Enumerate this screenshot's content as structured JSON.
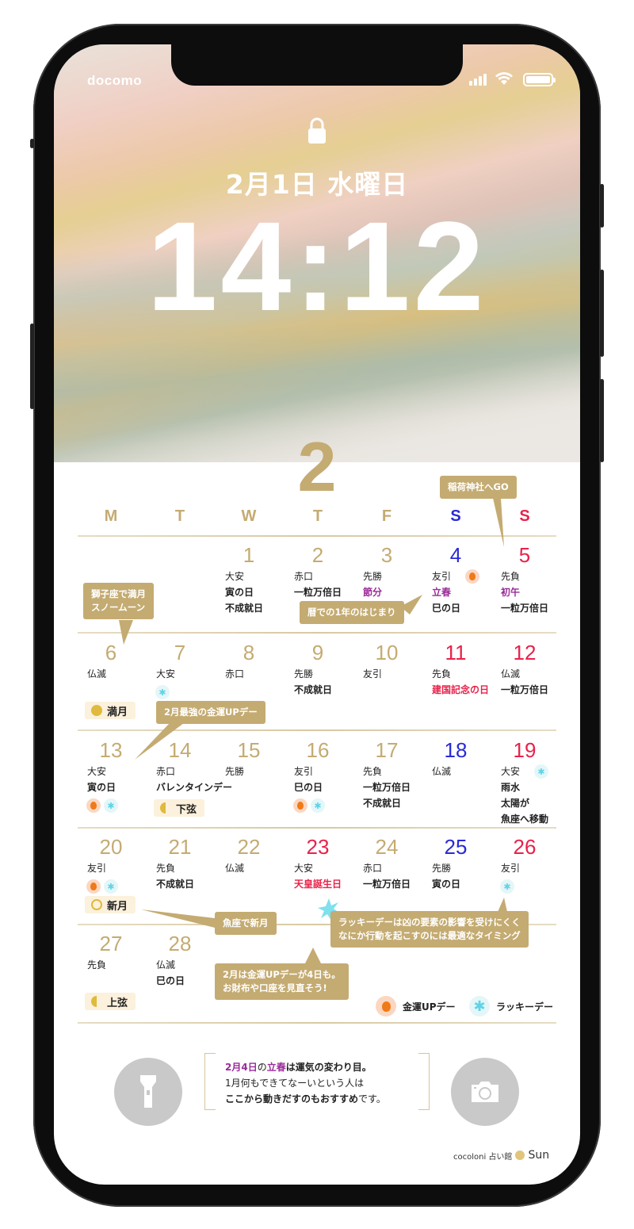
{
  "status": {
    "carrier": "docomo"
  },
  "lockscreen": {
    "date": "2月1日 水曜日",
    "time": "14:12"
  },
  "calendar": {
    "month": "2",
    "weekdays": [
      {
        "label": "M",
        "color": "gold"
      },
      {
        "label": "T",
        "color": "gold"
      },
      {
        "label": "W",
        "color": "gold"
      },
      {
        "label": "T",
        "color": "gold"
      },
      {
        "label": "F",
        "color": "gold"
      },
      {
        "label": "S",
        "color": "blue"
      },
      {
        "label": "S",
        "color": "red"
      }
    ],
    "weeks": [
      [
        null,
        null,
        {
          "day": "1",
          "color": "gold",
          "lines": [
            {
              "t": "大安"
            },
            {
              "t": "寅の日",
              "s": "b"
            },
            {
              "t": "不成就日",
              "s": "b"
            }
          ]
        },
        {
          "day": "2",
          "color": "gold",
          "lines": [
            {
              "t": "赤口"
            },
            {
              "t": "一粒万倍日",
              "s": "b"
            }
          ]
        },
        {
          "day": "3",
          "color": "gold",
          "lines": [
            {
              "t": "先勝"
            },
            {
              "t": "節分",
              "s": "purple"
            }
          ]
        },
        {
          "day": "4",
          "color": "blue",
          "lines": [
            {
              "t": "友引"
            },
            {
              "t": "立春",
              "s": "purple"
            },
            {
              "t": "巳の日",
              "s": "b"
            }
          ],
          "inline_icons": [
            "money"
          ]
        },
        {
          "day": "5",
          "color": "red",
          "lines": [
            {
              "t": "先負"
            },
            {
              "t": "初午",
              "s": "purple"
            },
            {
              "t": "一粒万倍日",
              "s": "b"
            }
          ]
        }
      ],
      [
        {
          "day": "6",
          "color": "gold",
          "lines": [
            {
              "t": "仏滅"
            }
          ],
          "moon": {
            "label": "満月",
            "phase": "full"
          }
        },
        {
          "day": "7",
          "color": "gold",
          "lines": [
            {
              "t": "大安"
            }
          ],
          "icons": [
            "lucky"
          ]
        },
        {
          "day": "8",
          "color": "gold",
          "lines": [
            {
              "t": "赤口"
            }
          ]
        },
        {
          "day": "9",
          "color": "gold",
          "lines": [
            {
              "t": "先勝"
            },
            {
              "t": "不成就日",
              "s": "b"
            }
          ]
        },
        {
          "day": "10",
          "color": "gold",
          "lines": [
            {
              "t": "友引"
            }
          ]
        },
        {
          "day": "11",
          "color": "red",
          "lines": [
            {
              "t": "先負"
            },
            {
              "t": "建国記念の日",
              "s": "red"
            }
          ]
        },
        {
          "day": "12",
          "color": "red",
          "lines": [
            {
              "t": "仏滅"
            },
            {
              "t": "一粒万倍日",
              "s": "b"
            }
          ]
        }
      ],
      [
        {
          "day": "13",
          "color": "gold",
          "lines": [
            {
              "t": "大安"
            },
            {
              "t": "寅の日",
              "s": "b"
            }
          ],
          "icons": [
            "money",
            "lucky"
          ]
        },
        {
          "day": "14",
          "color": "gold",
          "lines": [
            {
              "t": "赤口"
            },
            {
              "t": "バレンタインデー",
              "s": "b"
            }
          ],
          "moon": {
            "label": "下弦",
            "phase": "last"
          }
        },
        {
          "day": "15",
          "color": "gold",
          "lines": [
            {
              "t": "先勝"
            }
          ]
        },
        {
          "day": "16",
          "color": "gold",
          "lines": [
            {
              "t": "友引"
            },
            {
              "t": "巳の日",
              "s": "b"
            }
          ],
          "icons": [
            "money",
            "lucky"
          ]
        },
        {
          "day": "17",
          "color": "gold",
          "lines": [
            {
              "t": "先負"
            },
            {
              "t": "一粒万倍日",
              "s": "b"
            },
            {
              "t": "不成就日",
              "s": "b"
            }
          ]
        },
        {
          "day": "18",
          "color": "blue",
          "lines": [
            {
              "t": "仏滅"
            }
          ]
        },
        {
          "day": "19",
          "color": "red",
          "lines": [
            {
              "t": "大安"
            },
            {
              "t": "雨水",
              "s": "b"
            },
            {
              "t": "太陽が",
              "s": "b"
            },
            {
              "t": "魚座へ移動",
              "s": "b"
            }
          ],
          "inline_icons": [
            "lucky"
          ]
        }
      ],
      [
        {
          "day": "20",
          "color": "gold",
          "lines": [
            {
              "t": "友引"
            }
          ],
          "icons": [
            "money",
            "lucky"
          ],
          "moon": {
            "label": "新月",
            "phase": "new"
          }
        },
        {
          "day": "21",
          "color": "gold",
          "lines": [
            {
              "t": "先負"
            },
            {
              "t": "不成就日",
              "s": "b"
            }
          ]
        },
        {
          "day": "22",
          "color": "gold",
          "lines": [
            {
              "t": "仏滅"
            }
          ]
        },
        {
          "day": "23",
          "color": "red",
          "lines": [
            {
              "t": "大安"
            },
            {
              "t": "天皇誕生日",
              "s": "red"
            }
          ]
        },
        {
          "day": "24",
          "color": "gold",
          "lines": [
            {
              "t": "赤口"
            },
            {
              "t": "一粒万倍日",
              "s": "b"
            }
          ]
        },
        {
          "day": "25",
          "color": "blue",
          "lines": [
            {
              "t": "先勝"
            },
            {
              "t": "寅の日",
              "s": "b"
            }
          ]
        },
        {
          "day": "26",
          "color": "red",
          "lines": [
            {
              "t": "友引"
            }
          ],
          "icons": [
            "lucky"
          ]
        }
      ],
      [
        {
          "day": "27",
          "color": "gold",
          "lines": [
            {
              "t": "先負"
            }
          ],
          "moon": {
            "label": "上弦",
            "phase": "first"
          }
        },
        {
          "day": "28",
          "color": "gold",
          "lines": [
            {
              "t": "仏滅"
            },
            {
              "t": "巳の日",
              "s": "b"
            }
          ]
        },
        null,
        null,
        null,
        null,
        null
      ]
    ],
    "callouts": {
      "inari": "稲荷神社へGO",
      "snow_moon": "獅子座で満月\nスノームーン",
      "new_year": "暦での1年のはじまり",
      "strongest": "2月最強の金運UPデー",
      "pisces_new_moon": "魚座で新月",
      "lucky_note": "ラッキーデーは凶の要素の影響を受けにくく\nなにか行動を起こすのには最適なタイミング",
      "money_note": "2月は金運UPデーが4日も。\nお財布や口座を見直そう!"
    },
    "legend": [
      {
        "icon": "money",
        "label": "金運UPデー"
      },
      {
        "icon": "lucky",
        "label": "ラッキーデー"
      }
    ]
  },
  "message": {
    "l1a": "2月4日",
    "l1b": "の",
    "l1c": "立春",
    "l1d": "は運気の変わり目。",
    "l2": "1月何もできてなーいという人は",
    "l3a": "ここから動きだすのもおすすめ",
    "l3b": "です。"
  },
  "logo": {
    "text": "cocoloni 占い館",
    "brand": "Sun"
  },
  "colors": {
    "gold": "#c4ab72",
    "blue": "#2a2ad6",
    "red": "#e8224a",
    "purple": "#9a2a9a"
  }
}
